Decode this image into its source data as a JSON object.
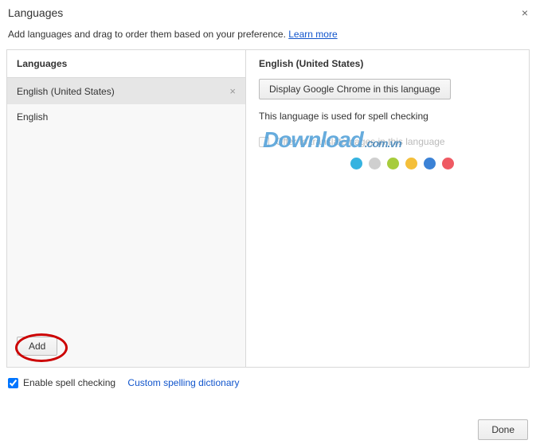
{
  "dialog": {
    "title": "Languages",
    "subtitle_prefix": "Add languages and drag to order them based on your preference. ",
    "learn_more": "Learn more"
  },
  "left": {
    "header": "Languages",
    "items": [
      {
        "label": "English (United States)",
        "selected": true
      },
      {
        "label": "English",
        "selected": false
      }
    ],
    "add_label": "Add"
  },
  "right": {
    "header": "English (United States)",
    "display_button": "Display Google Chrome in this language",
    "spell_note": "This language is used for spell checking",
    "offer_label": "Offer to translate pages in this language"
  },
  "footer": {
    "enable_spell": "Enable spell checking",
    "custom_dict": "Custom spelling dictionary",
    "done": "Done"
  },
  "watermark": {
    "text": "Download",
    "suffix": ".com.vn",
    "dot_colors": [
      "#36b3e0",
      "#cfcfcf",
      "#a7cc3c",
      "#f4bf3a",
      "#3b82d6",
      "#ef5a63"
    ]
  }
}
